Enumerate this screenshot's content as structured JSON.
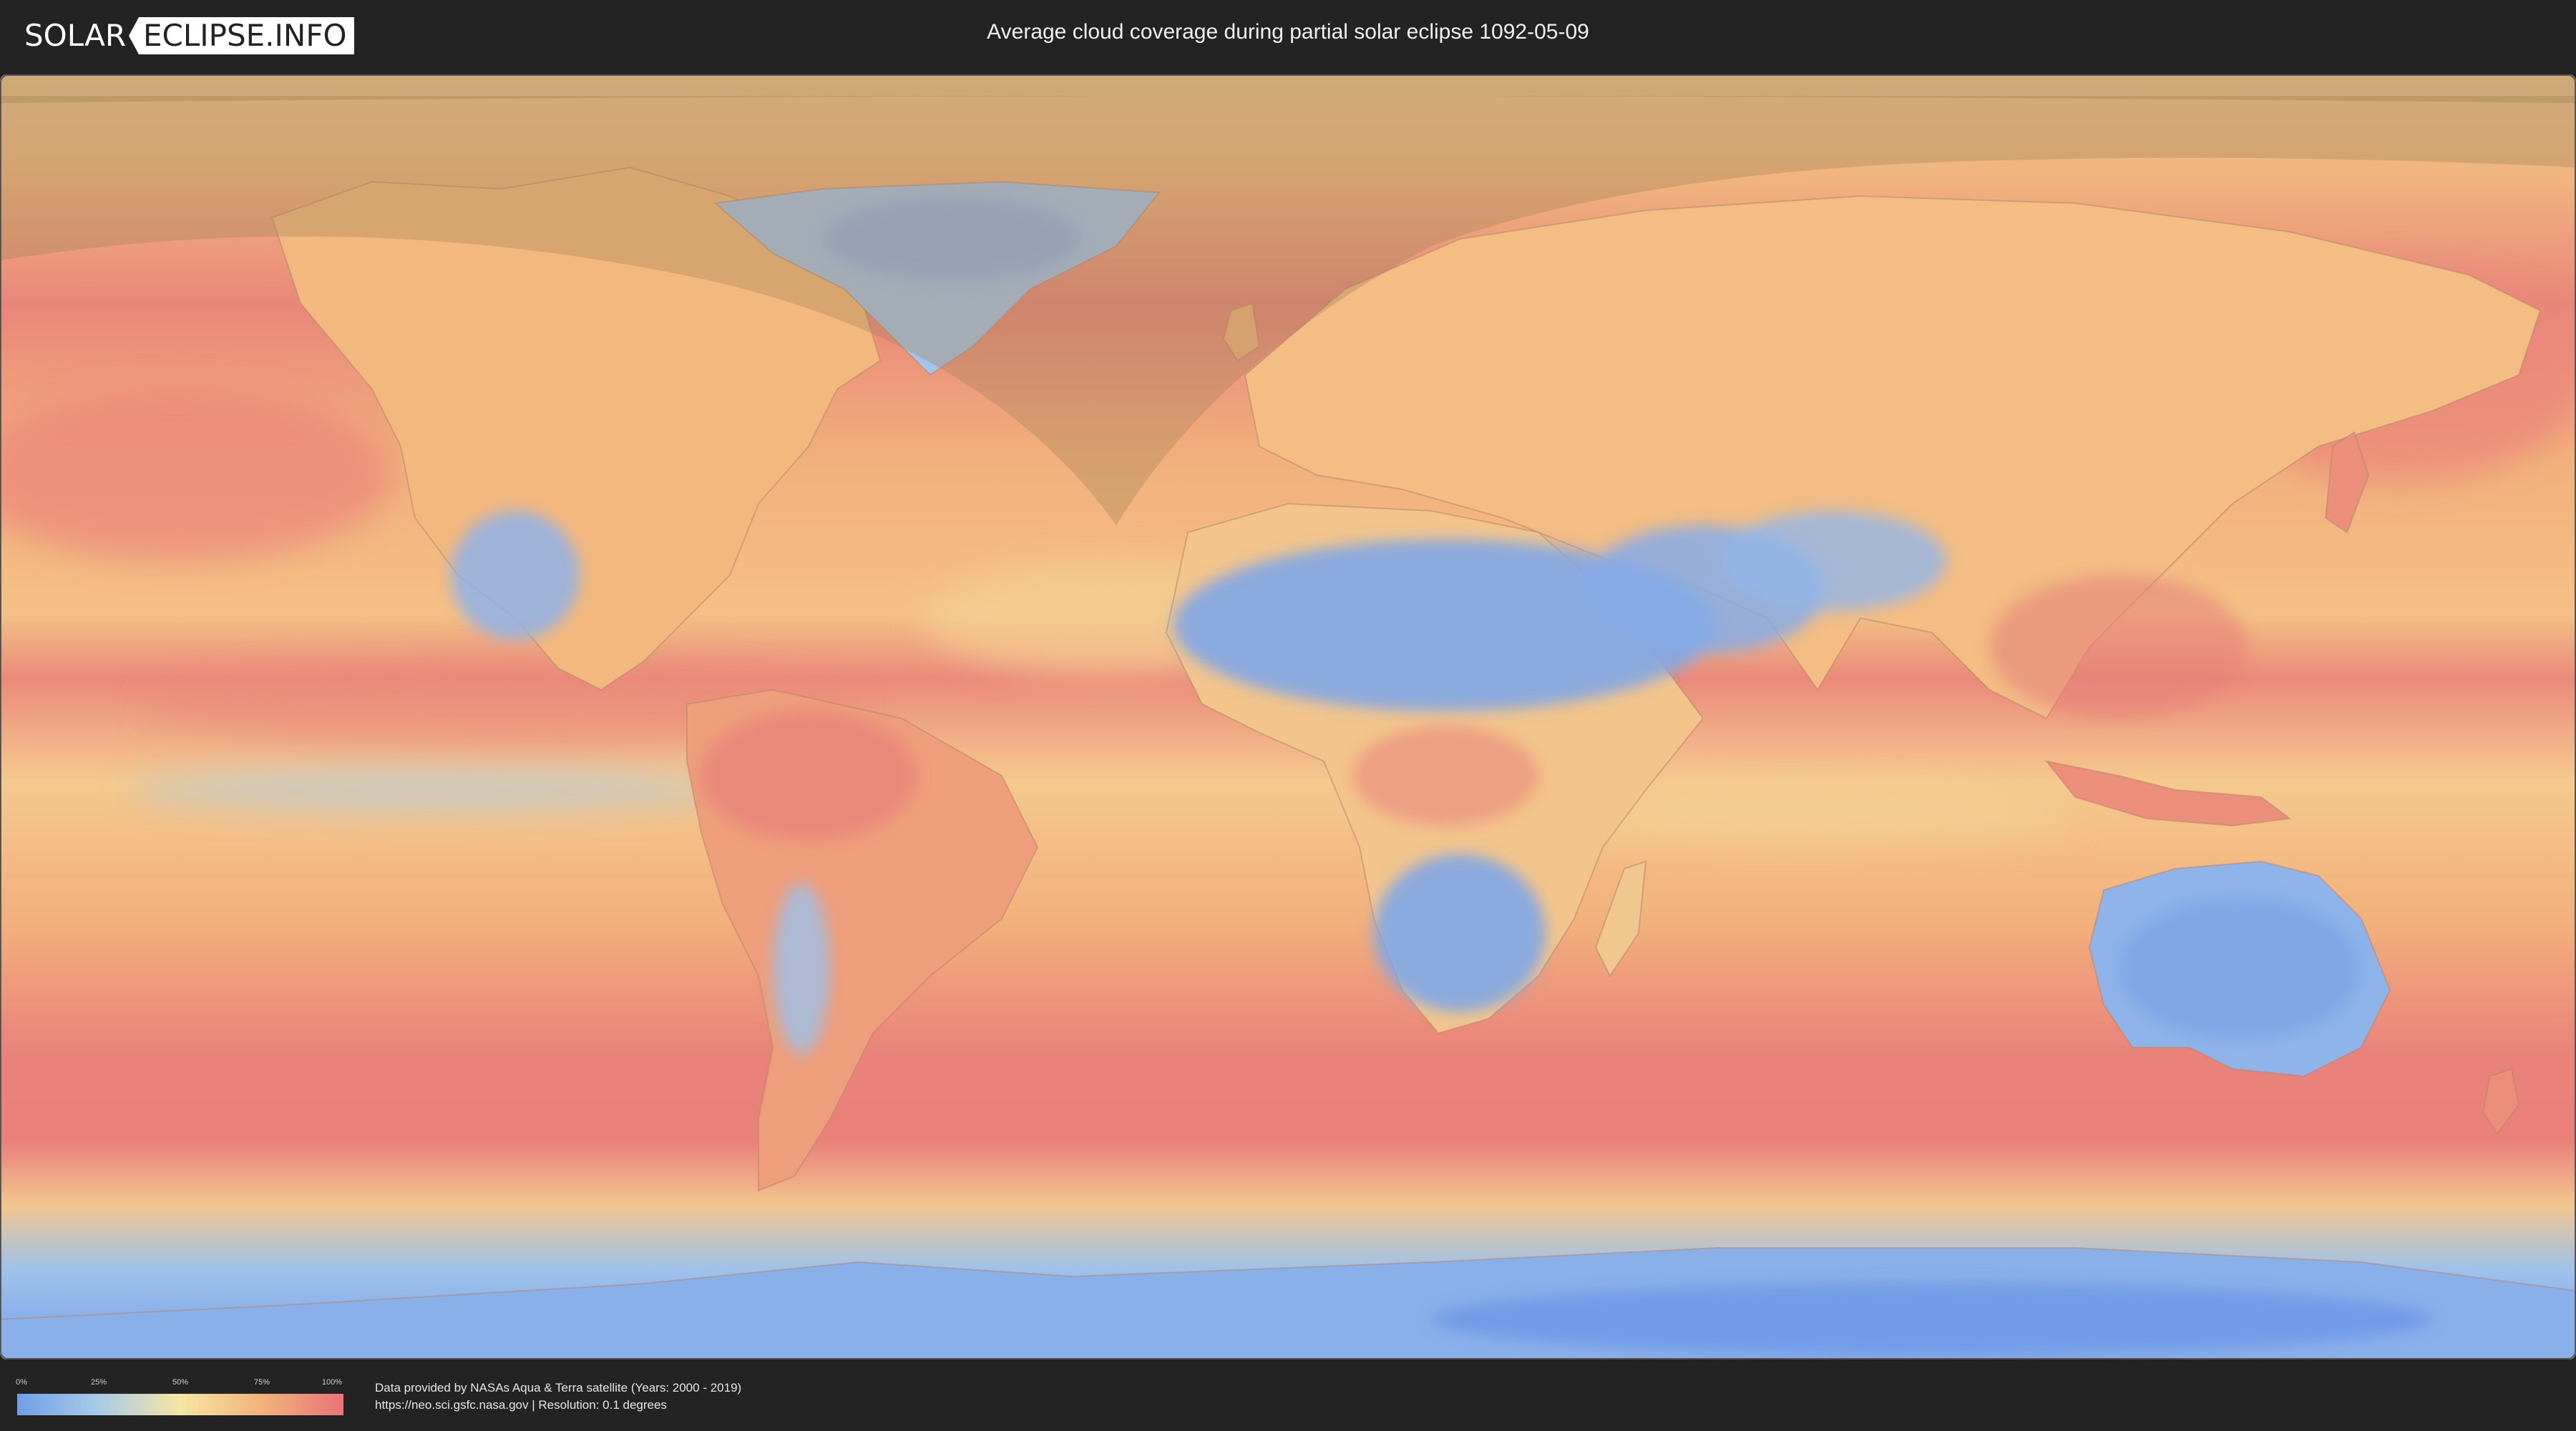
{
  "header": {
    "logo_part1": "SOLAR",
    "logo_part2": "ECLIPSE.INFO",
    "title": "Average cloud coverage during partial solar eclipse 1092-05-09"
  },
  "map": {
    "projection": "equirectangular world map",
    "colors": {
      "ocean_base": "#f2b079",
      "high_cloud": "#e8737a",
      "low_cloud": "#6f9ee8",
      "mid_cloud": "#f5e6a3",
      "eclipse_shadow_overlay": "#b48850"
    }
  },
  "legend": {
    "ticks": [
      "0%",
      "25%",
      "50%",
      "75%",
      "100%"
    ],
    "colors": [
      "#6f9ee8",
      "#a9cbe8",
      "#f5e6a3",
      "#f2b27a",
      "#e8737a"
    ]
  },
  "footer": {
    "line1": "Data provided by NASAs Aqua & Terra satellite (Years: 2000 - 2019)",
    "line2": "https://neo.sci.gsfc.nasa.gov | Resolution: 0.1 degrees"
  }
}
